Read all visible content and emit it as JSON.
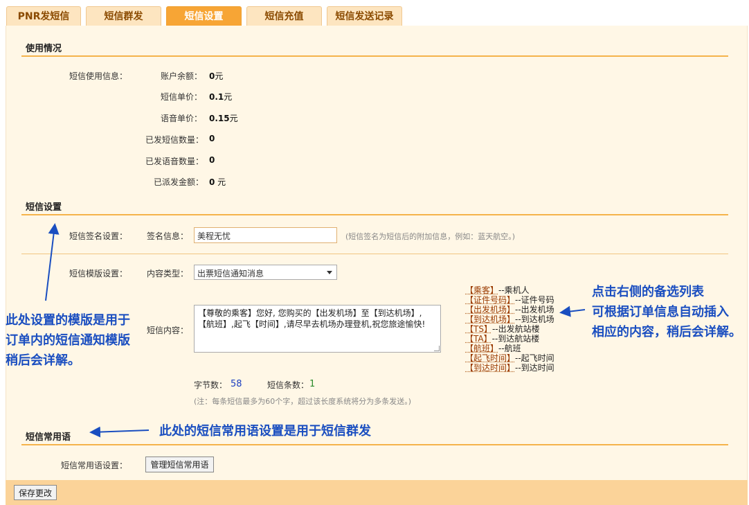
{
  "tabs": [
    {
      "label": "PNR发短信",
      "active": false
    },
    {
      "label": "短信群发",
      "active": false
    },
    {
      "label": "短信设置",
      "active": true
    },
    {
      "label": "短信充值",
      "active": false
    },
    {
      "label": "短信发送记录",
      "active": false
    }
  ],
  "usage": {
    "title": "使用情况",
    "group_label": "短信使用信息：",
    "rows": [
      {
        "label": "账户余额：",
        "value": "0",
        "unit": "元"
      },
      {
        "label": "短信单价：",
        "value": "0.1",
        "unit": "元"
      },
      {
        "label": "语音单价：",
        "value": "0.15",
        "unit": "元"
      },
      {
        "label": "已发短信数量：",
        "value": "0",
        "unit": ""
      },
      {
        "label": "已发语音数量：",
        "value": "0",
        "unit": ""
      },
      {
        "label": "已派发金额：",
        "value": "0",
        "unit": " 元"
      }
    ]
  },
  "settings": {
    "title": "短信设置",
    "signature_group": "短信签名设置：",
    "signature_label": "签名信息：",
    "signature_value": "美程无忧",
    "signature_hint": "(短信签名为短信后的附加信息，例如：蓝天航空。)",
    "template_group": "短信模版设置：",
    "content_type_label": "内容类型：",
    "content_type_value": "出票短信通知消息",
    "content_label": "短信内容：",
    "content_value": "【尊敬的乘客】您好, 您购买的【出发机场】至【到达机场】,【航班】,起飞【时间】,请尽早去机场办理登机,祝您旅途愉快!",
    "bytes_label": "字节数：",
    "bytes_value": "58",
    "count_label": "短信条数：",
    "count_value": "1",
    "note": "(注：每条短信最多为60个字，超过该长度系统将分为多条发送。)"
  },
  "tokens": [
    {
      "key": "【乘客】",
      "desc": "--乘机人"
    },
    {
      "key": "【证件号码】",
      "desc": "--证件号码"
    },
    {
      "key": "【出发机场】",
      "desc": "--出发机场"
    },
    {
      "key": "【到达机场】",
      "desc": "--到达机场"
    },
    {
      "key": "【TS】",
      "desc": "--出发航站楼"
    },
    {
      "key": "【TA】",
      "desc": "--到达航站楼"
    },
    {
      "key": "【航班】",
      "desc": "--航班"
    },
    {
      "key": "【起飞时间】",
      "desc": "--起飞时间"
    },
    {
      "key": "【到达时间】",
      "desc": "--到达时间"
    }
  ],
  "phrases": {
    "title": "短信常用语",
    "group_label": "短信常用语设置：",
    "manage_button": "管理短信常用语"
  },
  "annotations": {
    "left_lines": [
      "此处设置的模版是用于",
      "订单内的短信通知模版",
      "稍后会详解。"
    ],
    "right_lines": [
      "点击右侧的备选列表",
      "可根据订单信息自动插入",
      "相应的内容，稍后会详解。"
    ],
    "phrases_note": "此处的短信常用语设置是用于短信群发",
    "color": "#1a4ec0"
  },
  "footer": {
    "save_label": "保存更改"
  },
  "colors": {
    "accent": "#f7a535",
    "panel_bg": "#fff7e6",
    "footer_bg": "#fbd399"
  }
}
